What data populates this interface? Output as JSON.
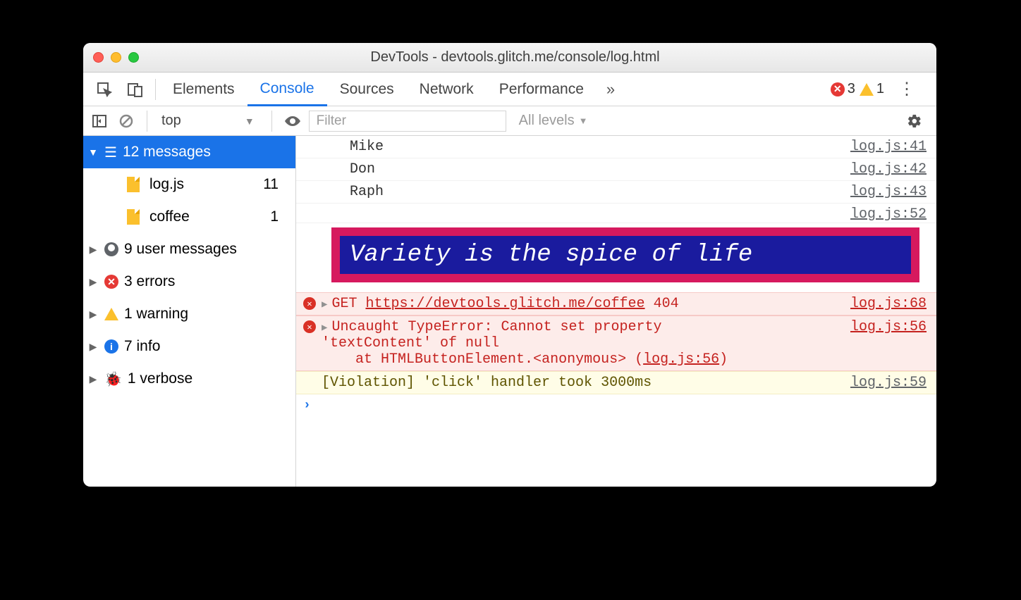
{
  "window": {
    "title": "DevTools - devtools.glitch.me/console/log.html"
  },
  "tabs": {
    "items": [
      "Elements",
      "Console",
      "Sources",
      "Network",
      "Performance"
    ],
    "active_index": 1,
    "overflow_glyph": "»",
    "error_count": "3",
    "warning_count": "1"
  },
  "toolbar": {
    "context": "top",
    "filter_placeholder": "Filter",
    "levels_label": "All levels"
  },
  "sidebar": {
    "messages": {
      "label": "12 messages"
    },
    "files": [
      {
        "name": "log.js",
        "count": "11"
      },
      {
        "name": "coffee",
        "count": "1"
      }
    ],
    "categories": [
      {
        "label": "9 user messages",
        "icon": "user"
      },
      {
        "label": "3 errors",
        "icon": "error"
      },
      {
        "label": "1 warning",
        "icon": "warning"
      },
      {
        "label": "7 info",
        "icon": "info"
      },
      {
        "label": "1 verbose",
        "icon": "bug"
      }
    ]
  },
  "console": {
    "lines": [
      {
        "text": "Mike",
        "src": "log.js:41"
      },
      {
        "text": "Don",
        "src": "log.js:42"
      },
      {
        "text": "Raph",
        "src": "log.js:43"
      }
    ],
    "styled": {
      "text": "Variety is the spice of life",
      "src": "log.js:52"
    },
    "net_error": {
      "method": "GET",
      "url": "https://devtools.glitch.me/coffee",
      "status": "404",
      "src": "log.js:68"
    },
    "exception": {
      "line1": "Uncaught TypeError: Cannot set property",
      "line2": "'textContent' of null",
      "stack_prefix": "    at HTMLButtonElement.",
      "stack_anon": "<anonymous>",
      "stack_open": " (",
      "stack_link": "log.js:56",
      "stack_close": ")",
      "src": "log.js:56"
    },
    "violation": {
      "text": "[Violation] 'click' handler took 3000ms",
      "src": "log.js:59"
    }
  }
}
